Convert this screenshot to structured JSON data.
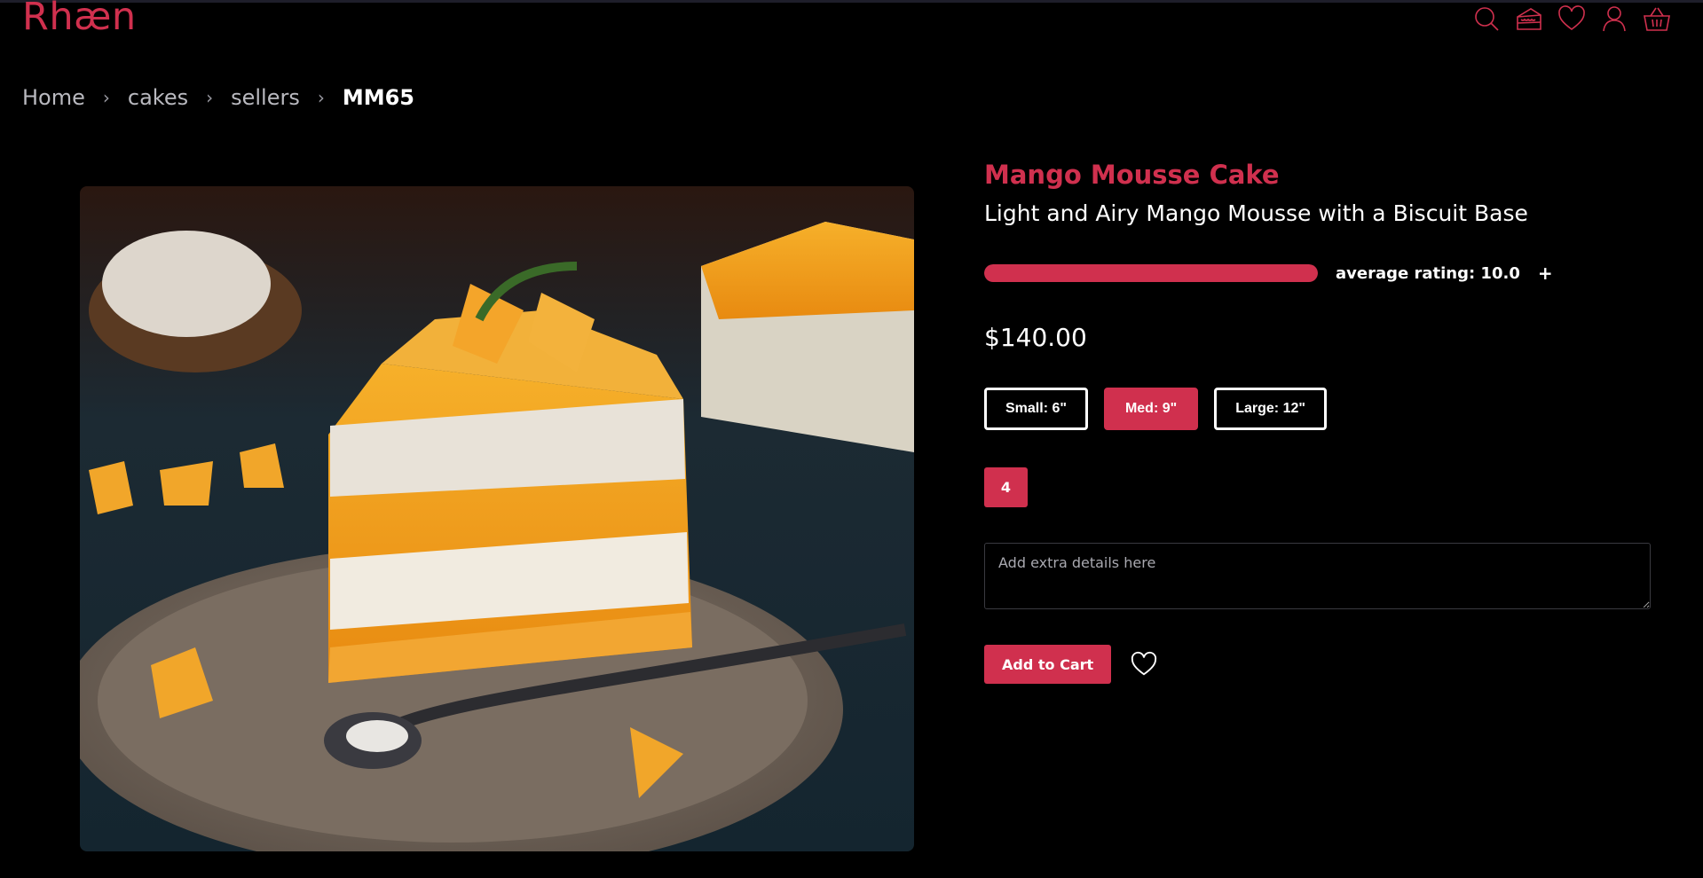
{
  "brand": {
    "name": "Rhæn",
    "color": "#d0304e"
  },
  "nav_icons": [
    "search-icon",
    "cake-icon",
    "heart-icon",
    "user-icon",
    "basket-icon"
  ],
  "breadcrumb": {
    "items": [
      "Home",
      "cakes",
      "sellers"
    ],
    "current": "MM65",
    "separator": "›"
  },
  "product": {
    "title": "Mango Mousse Cake",
    "subtitle": "Light and Airy Mango Mousse with a Biscuit Base",
    "rating_fraction": 1.0,
    "rating_label": "average rating: 10.0",
    "rating_add": "+",
    "price": "$140.00",
    "sizes": [
      "Small: 6\"",
      "Med: 9\"",
      "Large: 12\""
    ],
    "selected_size_index": 1,
    "quantity": "4",
    "notes_placeholder": "Add extra details here",
    "add_to_cart_label": "Add to Cart"
  }
}
